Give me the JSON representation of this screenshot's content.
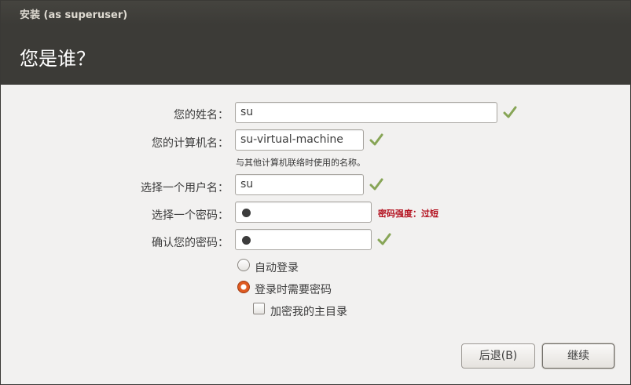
{
  "window": {
    "title": "安装 (as superuser)"
  },
  "header": {
    "title": "您是谁？"
  },
  "form": {
    "name": {
      "label": "您的姓名：",
      "value": "su"
    },
    "computer": {
      "label": "您的计算机名：",
      "value": "su-virtual-machine",
      "hint": "与其他计算机联络时使用的名称。"
    },
    "username": {
      "label": "选择一个用户名：",
      "value": "su"
    },
    "password": {
      "label": "选择一个密码：",
      "strength": "密码强度：过短"
    },
    "confirm": {
      "label": "确认您的密码："
    }
  },
  "options": {
    "auto_login": {
      "label": "自动登录",
      "selected": false
    },
    "require_password": {
      "label": "登录时需要密码",
      "selected": true
    },
    "encrypt_home": {
      "label": "加密我的主目录",
      "checked": false
    }
  },
  "buttons": {
    "back": "后退(B)",
    "continue": "继续"
  },
  "colors": {
    "header": "#3c3b37",
    "check": "#87a556",
    "radio_selected": "#df5a21",
    "strength_warning": "#b3101e"
  },
  "icons": {
    "valid": "checkmark-icon",
    "password_dot": "bullet"
  }
}
